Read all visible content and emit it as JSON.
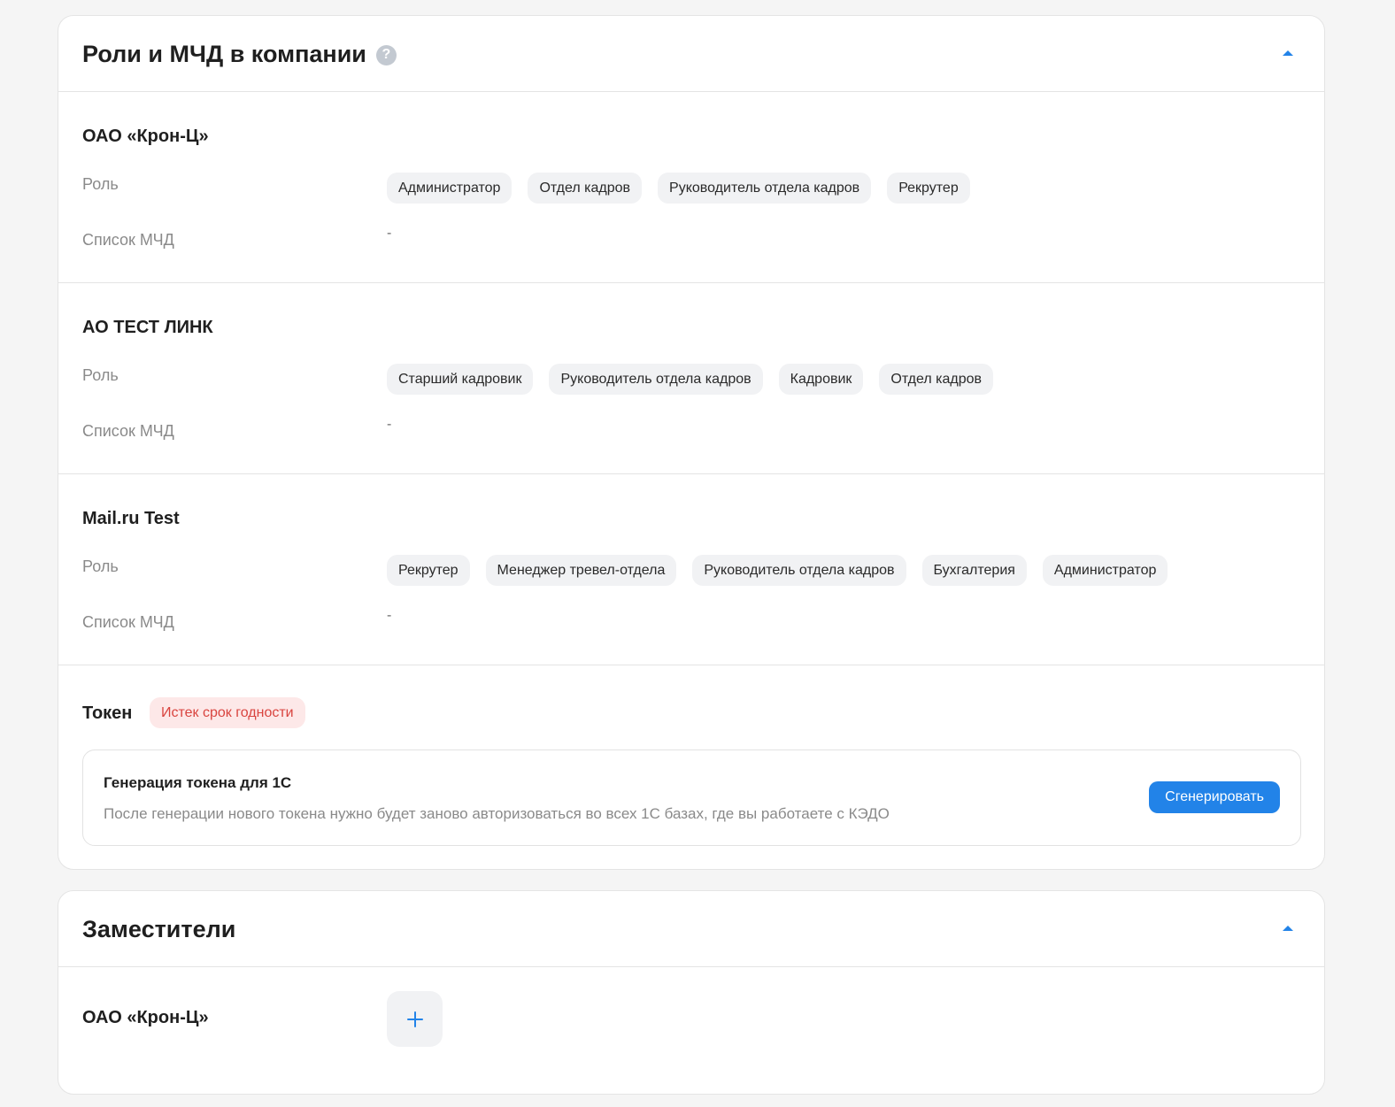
{
  "roles_card": {
    "title": "Роли и МЧД в компании",
    "help_glyph": "?",
    "companies": [
      {
        "name": "ОАО «Крон-Ц»",
        "role_label": "Роль",
        "roles": [
          "Администратор",
          "Отдел кадров",
          "Руководитель отдела кадров",
          "Рекрутер"
        ],
        "mcd_label": "Список МЧД",
        "mcd_value": "-"
      },
      {
        "name": "АО ТЕСТ ЛИНК",
        "role_label": "Роль",
        "roles": [
          "Старший кадровик",
          "Руководитель отдела кадров",
          "Кадровик",
          "Отдел кадров"
        ],
        "mcd_label": "Список МЧД",
        "mcd_value": "-"
      },
      {
        "name": "Mail.ru Test",
        "role_label": "Роль",
        "roles": [
          "Рекрутер",
          "Менеджер тревел-отдела",
          "Руководитель отдела кадров",
          "Бухгалтерия",
          "Администратор"
        ],
        "mcd_label": "Список МЧД",
        "mcd_value": "-"
      }
    ],
    "token": {
      "title": "Токен",
      "status_badge": "Истек срок годности",
      "box_title": "Генерация токена для 1С",
      "box_description": "После генерации нового токена нужно будет заново авторизоваться во всех 1С базах, где вы работаете с КЭДО",
      "generate_label": "Сгенерировать"
    }
  },
  "deputies_card": {
    "title": "Заместители",
    "company": "ОАО «Крон-Ц»"
  },
  "colors": {
    "accent": "#2283e8",
    "badge_bg": "#fde8e8",
    "badge_text": "#d9443f",
    "chip_bg": "#f1f2f4"
  }
}
